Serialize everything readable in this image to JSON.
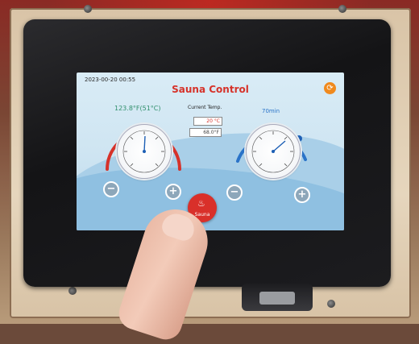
{
  "screen": {
    "datetime": "2023-00-20  00:55",
    "title": "Sauna Control",
    "left_temp": "123.8°F(51°C)",
    "current_temp_label": "Current Temp.",
    "current_c": "20 °C",
    "current_f": "68.0°F",
    "right_time": "70min",
    "sauna_button_label": "Sauna",
    "minus": "−",
    "plus": "+",
    "icons": {
      "refresh": "refresh-icon",
      "sauna": "person-icon"
    }
  },
  "colors": {
    "title": "#d6322a",
    "left_temp": "#2f8f6b",
    "right_time": "#2a73c8",
    "sauna_button": "#d9302a",
    "refresh_button": "#f08a1e"
  }
}
